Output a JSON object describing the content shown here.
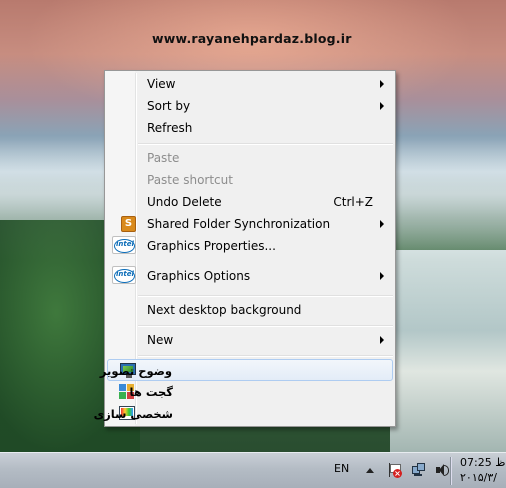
{
  "desktop": {
    "watermark": "www.rayanehpardaz.blog.ir"
  },
  "context_menu": {
    "groups": [
      {
        "items": [
          {
            "label": "View",
            "submenu": true,
            "enabled": true
          },
          {
            "label": "Sort by",
            "submenu": true,
            "enabled": true
          },
          {
            "label": "Refresh",
            "submenu": false,
            "enabled": true
          }
        ]
      },
      {
        "items": [
          {
            "label": "Paste",
            "enabled": false
          },
          {
            "label": "Paste shortcut",
            "enabled": false
          },
          {
            "label": "Undo Delete",
            "shortcut": "Ctrl+Z",
            "enabled": true
          },
          {
            "label": "Shared Folder Synchronization",
            "submenu": true,
            "icon": "sync-folder-icon",
            "enabled": true
          },
          {
            "label": "Graphics Properties...",
            "icon": "intel-icon",
            "enabled": true
          },
          {
            "label": "Graphics Options",
            "submenu": true,
            "icon": "intel-icon",
            "enabled": true
          }
        ]
      },
      {
        "items": [
          {
            "label": "Next desktop background",
            "enabled": true
          }
        ]
      },
      {
        "items": [
          {
            "label": "New",
            "submenu": true,
            "enabled": true
          }
        ]
      },
      {
        "items": [
          {
            "label": "وضوح تصویر",
            "icon": "display-resolution-icon",
            "highlighted": true,
            "enabled": true
          },
          {
            "label": "گجت ها",
            "icon": "gadgets-icon",
            "enabled": true
          },
          {
            "label": "شخصی سازی",
            "icon": "personalize-icon",
            "enabled": true
          }
        ]
      }
    ],
    "sync_icon_letter": "S",
    "intel_icon_text": "intel"
  },
  "taskbar": {
    "language": "EN",
    "time": "07:25 ظ",
    "date": "۲۰۱۵/۳/"
  },
  "colors": {
    "menu_background": "#f0f0f0",
    "highlight_border": "#aeccf1",
    "disabled_text": "#8d8d8d"
  }
}
